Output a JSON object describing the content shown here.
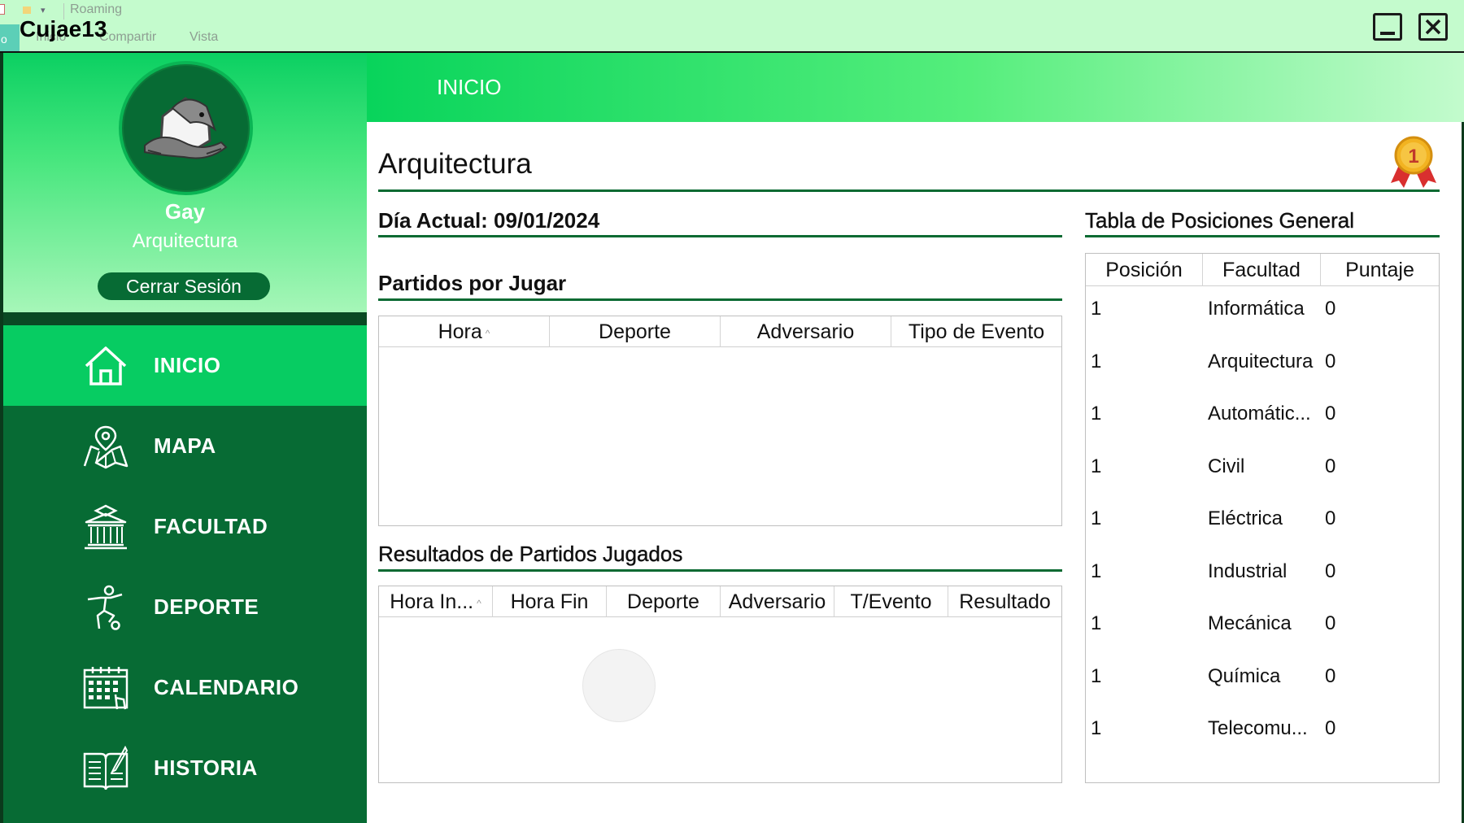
{
  "window": {
    "title": "Cujae13",
    "ghost": {
      "roaming": "Roaming",
      "inicio": "Inicio",
      "compartir": "Compartir",
      "vista": "Vista",
      "tab": "o"
    }
  },
  "sidebar": {
    "user_name": "Gay",
    "user_faculty": "Arquitectura",
    "logout_label": "Cerrar Sesión",
    "items": [
      {
        "label": "INICIO",
        "icon": "home-icon",
        "active": true
      },
      {
        "label": "MAPA",
        "icon": "map-icon",
        "active": false
      },
      {
        "label": "FACULTAD",
        "icon": "university-icon",
        "active": false
      },
      {
        "label": "DEPORTE",
        "icon": "athlete-icon",
        "active": false
      },
      {
        "label": "CALENDARIO",
        "icon": "calendar-icon",
        "active": false
      },
      {
        "label": "HISTORIA",
        "icon": "book-icon",
        "active": false
      }
    ]
  },
  "header": {
    "title": "INICIO"
  },
  "main": {
    "faculty_title": "Arquitectura",
    "current_date": "Día Actual: 09/01/2024",
    "upcoming": {
      "title": "Partidos por Jugar",
      "columns": [
        "Hora",
        "Deporte",
        "Adversario",
        "Tipo de Evento"
      ],
      "rows": []
    },
    "results": {
      "title": "Resultados de Partidos Jugados",
      "columns": [
        "Hora In...",
        "Hora Fin",
        "Deporte",
        "Adversario",
        "T/Evento",
        "Resultado"
      ],
      "rows": []
    },
    "standings": {
      "title": "Tabla de Posiciones General",
      "columns": [
        "Posición",
        "Facultad",
        "Puntaje"
      ],
      "rows": [
        {
          "pos": "1",
          "faculty": "Informática",
          "points": "0"
        },
        {
          "pos": "1",
          "faculty": "Arquitectura",
          "points": "0"
        },
        {
          "pos": "1",
          "faculty": "Automátic...",
          "points": "0"
        },
        {
          "pos": "1",
          "faculty": "Civil",
          "points": "0"
        },
        {
          "pos": "1",
          "faculty": "Eléctrica",
          "points": "0"
        },
        {
          "pos": "1",
          "faculty": "Industrial",
          "points": "0"
        },
        {
          "pos": "1",
          "faculty": "Mecánica",
          "points": "0"
        },
        {
          "pos": "1",
          "faculty": "Química",
          "points": "0"
        },
        {
          "pos": "1",
          "faculty": "Telecomu...",
          "points": "0"
        }
      ]
    },
    "medal_text": "1"
  },
  "colors": {
    "sidebar": "#076b34",
    "active_item": "#07cc62",
    "title_bar": "#c4fbcd",
    "rule": "#0a6a32"
  }
}
